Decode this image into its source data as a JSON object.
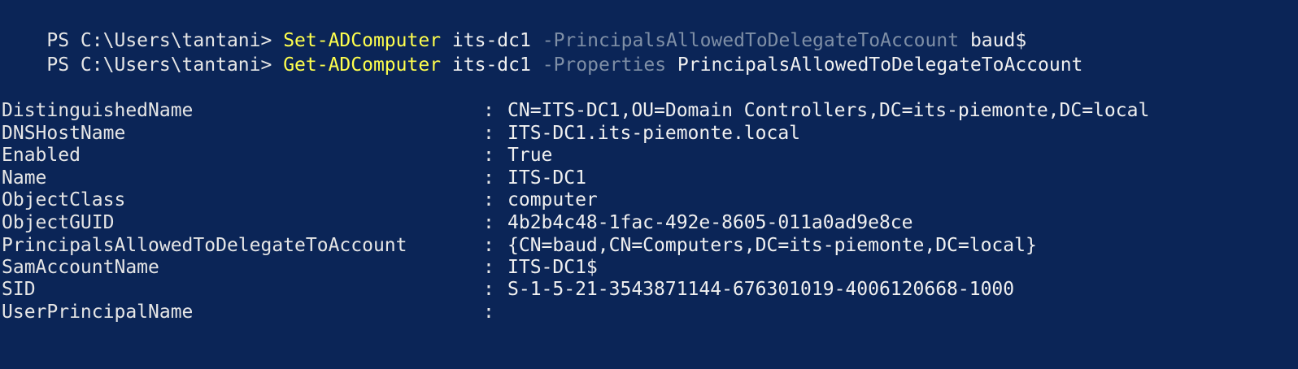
{
  "console": {
    "background": "#0b2557",
    "cmdlet_color": "#ffff4d",
    "param_color": "#7f8fa6",
    "commands": [
      {
        "prompt": "PS C:\\Users\\tantani> ",
        "cmdlet": "Set-ADComputer",
        "target": "its-dc1",
        "parameter": "-PrincipalsAllowedToDelegateToAccount",
        "argument": "baud$"
      },
      {
        "prompt": "PS C:\\Users\\tantani> ",
        "cmdlet": "Get-ADComputer",
        "target": "its-dc1",
        "parameter": "-Properties",
        "argument": "PrincipalsAllowedToDelegateToAccount"
      }
    ],
    "separator": ":",
    "properties": [
      {
        "name": "DistinguishedName",
        "value": "CN=ITS-DC1,OU=Domain Controllers,DC=its-piemonte,DC=local"
      },
      {
        "name": "DNSHostName",
        "value": "ITS-DC1.its-piemonte.local"
      },
      {
        "name": "Enabled",
        "value": "True"
      },
      {
        "name": "Name",
        "value": "ITS-DC1"
      },
      {
        "name": "ObjectClass",
        "value": "computer"
      },
      {
        "name": "ObjectGUID",
        "value": "4b2b4c48-1fac-492e-8605-011a0ad9e8ce"
      },
      {
        "name": "PrincipalsAllowedToDelegateToAccount",
        "value": "{CN=baud,CN=Computers,DC=its-piemonte,DC=local}"
      },
      {
        "name": "SamAccountName",
        "value": "ITS-DC1$"
      },
      {
        "name": "SID",
        "value": "S-1-5-21-3543871144-676301019-4006120668-1000"
      },
      {
        "name": "UserPrincipalName",
        "value": ""
      }
    ]
  }
}
